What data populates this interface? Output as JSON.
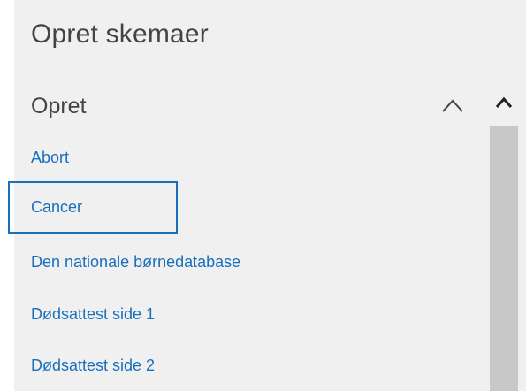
{
  "panel": {
    "title": "Opret skemaer"
  },
  "section": {
    "title": "Opret",
    "collapse_icon": "chevron-up-icon"
  },
  "items": [
    {
      "label": "Abort",
      "selected": false
    },
    {
      "label": "Cancer",
      "selected": true
    },
    {
      "label": "Den nationale børnedatabase",
      "selected": false
    },
    {
      "label": "Dødsattest side 1",
      "selected": false
    },
    {
      "label": "Dødsattest side 2",
      "selected": false
    }
  ],
  "scrollbar": {
    "up_icon": "chevron-up-icon"
  },
  "colors": {
    "panel_bg": "#f0f0f0",
    "link": "#1a6fbd",
    "heading": "#444444",
    "scroll_thumb": "#c8c8c8"
  }
}
